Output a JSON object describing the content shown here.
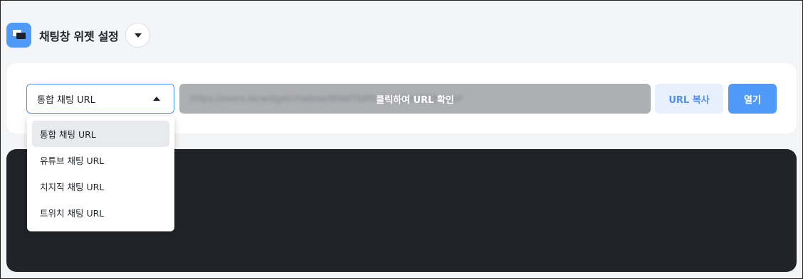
{
  "header": {
    "title": "채팅창 위젯 설정",
    "app_icon": "chat-widget-icon",
    "toggle_icon": "caret-down-icon"
  },
  "url_bar": {
    "select": {
      "selected": "통합 채팅 URL",
      "icon": "caret-up-icon",
      "options": [
        "통합 채팅 URL",
        "유튜브 채팅 URL",
        "치지직 채팅 URL",
        "트위치 채팅 URL"
      ]
    },
    "url_field": {
      "blurred_text": "https://overs.ak/widget/chatbox/8f4bf7b8f0c3c7a0de6f18ab3ef",
      "label": "클릭하여 URL 확인"
    },
    "copy_label": "URL 복사",
    "open_label": "열기"
  },
  "colors": {
    "accent": "#4f9af8",
    "select_border": "#4f8ff0",
    "copy_bg": "#e8f0fd",
    "dark_panel": "#202327",
    "background": "#f4f5f7"
  }
}
